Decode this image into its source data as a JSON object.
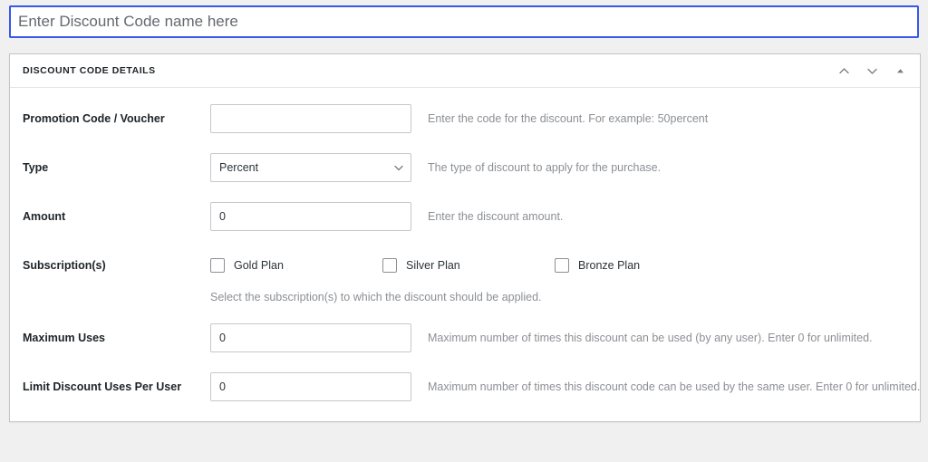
{
  "title_field": {
    "value": "",
    "placeholder": "Enter Discount Code name here"
  },
  "panel": {
    "heading": "DISCOUNT CODE DETAILS",
    "actions": [
      {
        "name": "move-up-icon",
        "label": "Move up"
      },
      {
        "name": "move-down-icon",
        "label": "Move down"
      },
      {
        "name": "toggle-panel-icon",
        "label": "Toggle panel"
      }
    ]
  },
  "fields": {
    "promotion_code": {
      "label": "Promotion Code / Voucher",
      "value": "",
      "placeholder": "",
      "help": "Enter the code for the discount. For example: 50percent"
    },
    "type": {
      "label": "Type",
      "value": "Percent",
      "options": [
        "Percent"
      ],
      "help": "The type of discount to apply for the purchase."
    },
    "amount": {
      "label": "Amount",
      "value": "0",
      "help": "Enter the discount amount."
    },
    "subscriptions": {
      "label": "Subscription(s)",
      "options": [
        {
          "label": "Gold Plan",
          "checked": false
        },
        {
          "label": "Silver Plan",
          "checked": false
        },
        {
          "label": "Bronze Plan",
          "checked": false
        }
      ],
      "help": "Select the subscription(s) to which the discount should be applied."
    },
    "maximum_uses": {
      "label": "Maximum Uses",
      "value": "0",
      "help": "Maximum number of times this discount can be used (by any user). Enter 0 for unlimited."
    },
    "limit_per_user": {
      "label": "Limit Discount Uses Per User",
      "value": "0",
      "help": "Maximum number of times this discount code can be used by the same user. Enter 0 for unlimited."
    }
  },
  "colors": {
    "focus_border": "#3858e9",
    "page_background": "#f0f0f1",
    "panel_border": "#c3c4c7",
    "help_text": "#8c8f94"
  }
}
